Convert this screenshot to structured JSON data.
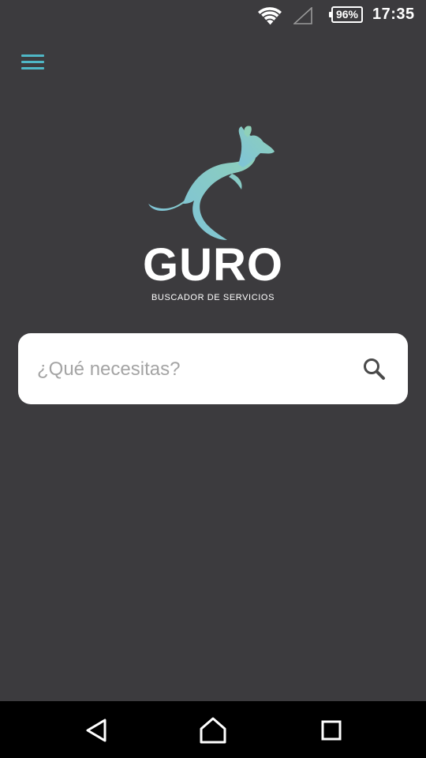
{
  "status_bar": {
    "battery": "96%",
    "time": "17:35",
    "icons": [
      "wifi-icon",
      "cell-signal-icon",
      "battery-icon"
    ]
  },
  "header": {
    "menu_icon": "hamburger-menu-icon"
  },
  "brand": {
    "name": "GURO",
    "tagline": "BUSCADOR DE SERVICIOS",
    "logo_icon": "kangaroo-logo-icon",
    "accent_color": "#4fb7c6"
  },
  "search": {
    "placeholder": "¿Qué necesitas?",
    "value": "",
    "icon": "search-icon"
  },
  "nav_bar": {
    "icons": [
      "back-icon",
      "home-icon",
      "recents-icon"
    ]
  },
  "colors": {
    "background": "#3c3b3e",
    "search_background": "#ffffff",
    "nav_bar": "#000000"
  }
}
